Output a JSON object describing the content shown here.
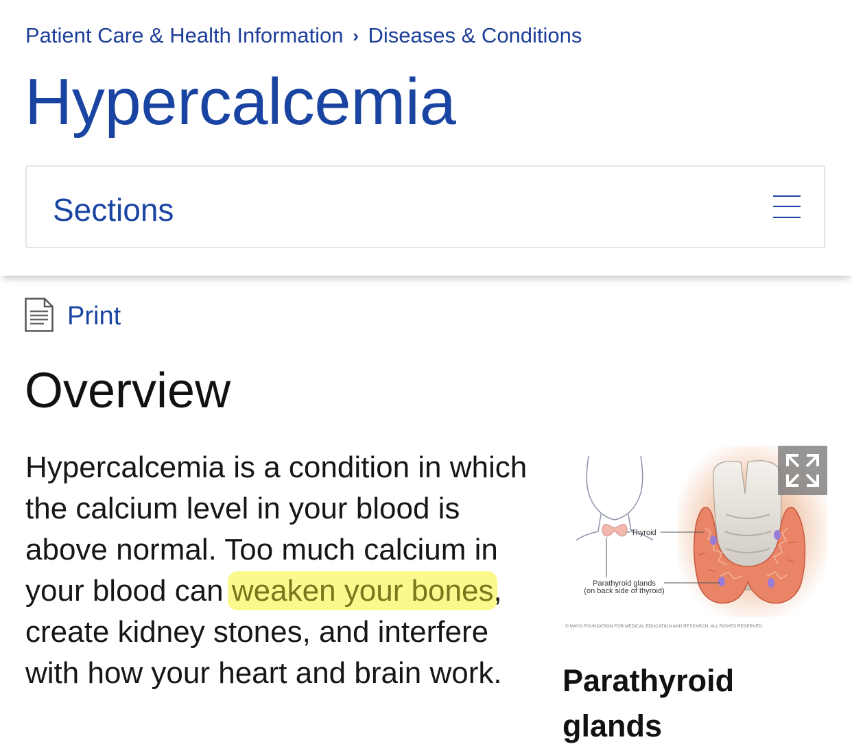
{
  "breadcrumb": {
    "items": [
      "Patient Care & Health Information",
      "Diseases & Conditions"
    ],
    "separator": "›"
  },
  "page": {
    "title": "Hypercalcemia"
  },
  "sections": {
    "label": "Sections",
    "menu_icon": "hamburger-menu-icon"
  },
  "print": {
    "label": "Print",
    "icon": "document-icon"
  },
  "overview": {
    "heading": "Overview",
    "text_before": "Hypercalcemia is a condition in which the calcium level in your blood is above normal. Too much calcium in your blood can ",
    "highlighted": "weaken your bones",
    "text_after": ", create kidney stones, and interfere with how your heart and brain work."
  },
  "figure": {
    "label_thyroid": "Thyroid",
    "label_parathyroid_1": "Parathyroid glands",
    "label_parathyroid_2": "(on back side of thyroid)",
    "copyright": "© MAYO FOUNDATION FOR MEDICAL EDUCATION AND RESEARCH. ALL RIGHTS RESERVED.",
    "caption": "Parathyroid glands",
    "expand_icon": "expand-icon"
  },
  "colors": {
    "link_blue": "#1d3f99",
    "title_blue": "#1a44a1",
    "highlight": "#faf66e"
  }
}
